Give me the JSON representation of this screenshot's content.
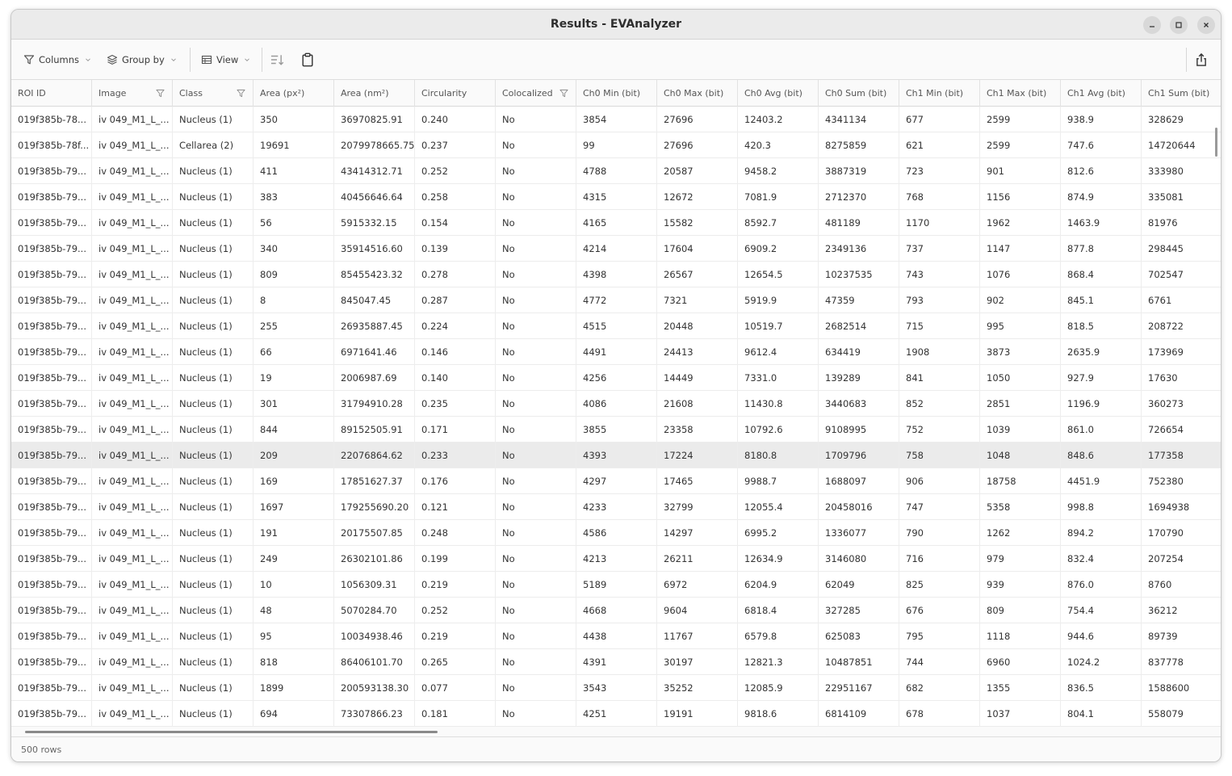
{
  "window": {
    "title": "Results - EVAnalyzer"
  },
  "toolbar": {
    "columns_label": "Columns",
    "group_by_label": "Group by",
    "view_label": "View"
  },
  "table": {
    "headers": [
      {
        "label": "ROI ID",
        "filter": false
      },
      {
        "label": "Image",
        "filter": true
      },
      {
        "label": "Class",
        "filter": true
      },
      {
        "label": "Area (px²)",
        "filter": false
      },
      {
        "label": "Area (nm²)",
        "filter": false
      },
      {
        "label": "Circularity",
        "filter": false
      },
      {
        "label": "Colocalized",
        "filter": true
      },
      {
        "label": "Ch0 Min (bit)",
        "filter": false
      },
      {
        "label": "Ch0 Max (bit)",
        "filter": false
      },
      {
        "label": "Ch0 Avg (bit)",
        "filter": false
      },
      {
        "label": "Ch0 Sum (bit)",
        "filter": false
      },
      {
        "label": "Ch1 Min (bit)",
        "filter": false
      },
      {
        "label": "Ch1 Max (bit)",
        "filter": false
      },
      {
        "label": "Ch1 Avg (bit)",
        "filter": false
      },
      {
        "label": "Ch1 Sum (bit)",
        "filter": false
      }
    ],
    "highlighted_row": 13,
    "rows": [
      [
        "019f385b-78...",
        "iv 049_M1_L_...",
        "Nucleus (1)",
        "350",
        "36970825.91",
        "0.240",
        "No",
        "3854",
        "27696",
        "12403.2",
        "4341134",
        "677",
        "2599",
        "938.9",
        "328629"
      ],
      [
        "019f385b-78f...",
        "iv 049_M1_L_...",
        "Cellarea (2)",
        "19691",
        "2079978665.75",
        "0.237",
        "No",
        "99",
        "27696",
        "420.3",
        "8275859",
        "621",
        "2599",
        "747.6",
        "14720644"
      ],
      [
        "019f385b-79...",
        "iv 049_M1_L_...",
        "Nucleus (1)",
        "411",
        "43414312.71",
        "0.252",
        "No",
        "4788",
        "20587",
        "9458.2",
        "3887319",
        "723",
        "901",
        "812.6",
        "333980"
      ],
      [
        "019f385b-79...",
        "iv 049_M1_L_...",
        "Nucleus (1)",
        "383",
        "40456646.64",
        "0.258",
        "No",
        "4315",
        "12672",
        "7081.9",
        "2712370",
        "768",
        "1156",
        "874.9",
        "335081"
      ],
      [
        "019f385b-79...",
        "iv 049_M1_L_...",
        "Nucleus (1)",
        "56",
        "5915332.15",
        "0.154",
        "No",
        "4165",
        "15582",
        "8592.7",
        "481189",
        "1170",
        "1962",
        "1463.9",
        "81976"
      ],
      [
        "019f385b-79...",
        "iv 049_M1_L_...",
        "Nucleus (1)",
        "340",
        "35914516.60",
        "0.139",
        "No",
        "4214",
        "17604",
        "6909.2",
        "2349136",
        "737",
        "1147",
        "877.8",
        "298445"
      ],
      [
        "019f385b-79...",
        "iv 049_M1_L_...",
        "Nucleus (1)",
        "809",
        "85455423.32",
        "0.278",
        "No",
        "4398",
        "26567",
        "12654.5",
        "10237535",
        "743",
        "1076",
        "868.4",
        "702547"
      ],
      [
        "019f385b-79...",
        "iv 049_M1_L_...",
        "Nucleus (1)",
        "8",
        "845047.45",
        "0.287",
        "No",
        "4772",
        "7321",
        "5919.9",
        "47359",
        "793",
        "902",
        "845.1",
        "6761"
      ],
      [
        "019f385b-79...",
        "iv 049_M1_L_...",
        "Nucleus (1)",
        "255",
        "26935887.45",
        "0.224",
        "No",
        "4515",
        "20448",
        "10519.7",
        "2682514",
        "715",
        "995",
        "818.5",
        "208722"
      ],
      [
        "019f385b-79...",
        "iv 049_M1_L_...",
        "Nucleus (1)",
        "66",
        "6971641.46",
        "0.146",
        "No",
        "4491",
        "24413",
        "9612.4",
        "634419",
        "1908",
        "3873",
        "2635.9",
        "173969"
      ],
      [
        "019f385b-79...",
        "iv 049_M1_L_...",
        "Nucleus (1)",
        "19",
        "2006987.69",
        "0.140",
        "No",
        "4256",
        "14449",
        "7331.0",
        "139289",
        "841",
        "1050",
        "927.9",
        "17630"
      ],
      [
        "019f385b-79...",
        "iv 049_M1_L_...",
        "Nucleus (1)",
        "301",
        "31794910.28",
        "0.235",
        "No",
        "4086",
        "21608",
        "11430.8",
        "3440683",
        "852",
        "2851",
        "1196.9",
        "360273"
      ],
      [
        "019f385b-79...",
        "iv 049_M1_L_...",
        "Nucleus (1)",
        "844",
        "89152505.91",
        "0.171",
        "No",
        "3855",
        "23358",
        "10792.6",
        "9108995",
        "752",
        "1039",
        "861.0",
        "726654"
      ],
      [
        "019f385b-79...",
        "iv 049_M1_L_...",
        "Nucleus (1)",
        "209",
        "22076864.62",
        "0.233",
        "No",
        "4393",
        "17224",
        "8180.8",
        "1709796",
        "758",
        "1048",
        "848.6",
        "177358"
      ],
      [
        "019f385b-79...",
        "iv 049_M1_L_...",
        "Nucleus (1)",
        "169",
        "17851627.37",
        "0.176",
        "No",
        "4297",
        "17465",
        "9988.7",
        "1688097",
        "906",
        "18758",
        "4451.9",
        "752380"
      ],
      [
        "019f385b-79...",
        "iv 049_M1_L_...",
        "Nucleus (1)",
        "1697",
        "179255690.20",
        "0.121",
        "No",
        "4233",
        "32799",
        "12055.4",
        "20458016",
        "747",
        "5358",
        "998.8",
        "1694938"
      ],
      [
        "019f385b-79...",
        "iv 049_M1_L_...",
        "Nucleus (1)",
        "191",
        "20175507.85",
        "0.248",
        "No",
        "4586",
        "14297",
        "6995.2",
        "1336077",
        "790",
        "1262",
        "894.2",
        "170790"
      ],
      [
        "019f385b-79...",
        "iv 049_M1_L_...",
        "Nucleus (1)",
        "249",
        "26302101.86",
        "0.199",
        "No",
        "4213",
        "26211",
        "12634.9",
        "3146080",
        "716",
        "979",
        "832.4",
        "207254"
      ],
      [
        "019f385b-79...",
        "iv 049_M1_L_...",
        "Nucleus (1)",
        "10",
        "1056309.31",
        "0.219",
        "No",
        "5189",
        "6972",
        "6204.9",
        "62049",
        "825",
        "939",
        "876.0",
        "8760"
      ],
      [
        "019f385b-79...",
        "iv 049_M1_L_...",
        "Nucleus (1)",
        "48",
        "5070284.70",
        "0.252",
        "No",
        "4668",
        "9604",
        "6818.4",
        "327285",
        "676",
        "809",
        "754.4",
        "36212"
      ],
      [
        "019f385b-79...",
        "iv 049_M1_L_...",
        "Nucleus (1)",
        "95",
        "10034938.46",
        "0.219",
        "No",
        "4438",
        "11767",
        "6579.8",
        "625083",
        "795",
        "1118",
        "944.6",
        "89739"
      ],
      [
        "019f385b-79...",
        "iv 049_M1_L_...",
        "Nucleus (1)",
        "818",
        "86406101.70",
        "0.265",
        "No",
        "4391",
        "30197",
        "12821.3",
        "10487851",
        "744",
        "6960",
        "1024.2",
        "837778"
      ],
      [
        "019f385b-79...",
        "iv 049_M1_L_...",
        "Nucleus (1)",
        "1899",
        "200593138.30",
        "0.077",
        "No",
        "3543",
        "35252",
        "12085.9",
        "22951167",
        "682",
        "1355",
        "836.5",
        "1588600"
      ],
      [
        "019f385b-79...",
        "iv 049_M1_L_...",
        "Nucleus (1)",
        "694",
        "73307866.23",
        "0.181",
        "No",
        "4251",
        "19191",
        "9818.6",
        "6814109",
        "678",
        "1037",
        "804.1",
        "558079"
      ]
    ]
  },
  "status": {
    "row_count": "500 rows"
  }
}
